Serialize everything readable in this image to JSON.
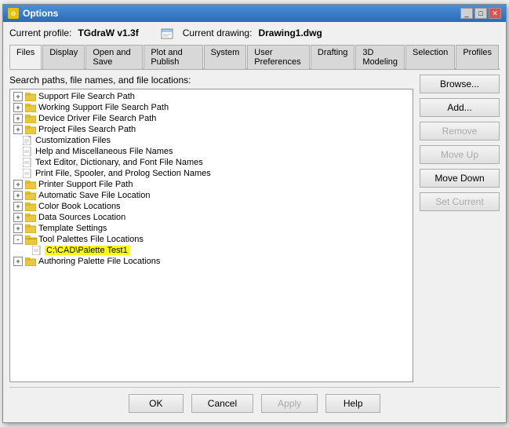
{
  "window": {
    "title": "Options",
    "icon": "⚙",
    "controls": [
      "_",
      "□",
      "✕"
    ]
  },
  "profile_row": {
    "current_profile_label": "Current profile:",
    "current_profile_value": "TGdraW v1.3f",
    "current_drawing_label": "Current drawing:",
    "current_drawing_value": "Drawing1.dwg"
  },
  "tabs": [
    {
      "label": "Files",
      "active": true
    },
    {
      "label": "Display",
      "active": false
    },
    {
      "label": "Open and Save",
      "active": false
    },
    {
      "label": "Plot and Publish",
      "active": false
    },
    {
      "label": "System",
      "active": false
    },
    {
      "label": "User Preferences",
      "active": false
    },
    {
      "label": "Drafting",
      "active": false
    },
    {
      "label": "3D Modeling",
      "active": false
    },
    {
      "label": "Selection",
      "active": false
    },
    {
      "label": "Profiles",
      "active": false
    }
  ],
  "search_paths_label": "Search paths, file names, and file locations:",
  "tree_items": [
    {
      "label": "Support File Search Path",
      "level": 0,
      "type": "folder",
      "expandable": true,
      "expanded": false
    },
    {
      "label": "Working Support File Search Path",
      "level": 0,
      "type": "folder",
      "expandable": true,
      "expanded": false
    },
    {
      "label": "Device Driver File Search Path",
      "level": 0,
      "type": "folder",
      "expandable": true,
      "expanded": false
    },
    {
      "label": "Project Files Search Path",
      "level": 0,
      "type": "folder",
      "expandable": true,
      "expanded": false
    },
    {
      "label": "Customization Files",
      "level": 0,
      "type": "doc",
      "expandable": false
    },
    {
      "label": "Help and Miscellaneous File Names",
      "level": 0,
      "type": "doc",
      "expandable": false
    },
    {
      "label": "Text Editor, Dictionary, and Font File Names",
      "level": 0,
      "type": "doc",
      "expandable": false
    },
    {
      "label": "Print File, Spooler, and Prolog Section Names",
      "level": 0,
      "type": "doc",
      "expandable": false
    },
    {
      "label": "Printer Support File Path",
      "level": 0,
      "type": "folder",
      "expandable": true,
      "expanded": false
    },
    {
      "label": "Automatic Save File Location",
      "level": 0,
      "type": "folder",
      "expandable": true,
      "expanded": false
    },
    {
      "label": "Color Book Locations",
      "level": 0,
      "type": "folder",
      "expandable": true,
      "expanded": false
    },
    {
      "label": "Data Sources Location",
      "level": 0,
      "type": "folder",
      "expandable": true,
      "expanded": false
    },
    {
      "label": "Template Settings",
      "level": 0,
      "type": "folder",
      "expandable": true,
      "expanded": false
    },
    {
      "label": "Tool Palettes File Locations",
      "level": 0,
      "type": "folder_special",
      "expandable": true,
      "expanded": true
    },
    {
      "label": "C:\\CAD\\Palette Test1",
      "level": 1,
      "type": "path",
      "expandable": false,
      "selected": true
    },
    {
      "label": "Authoring Palette File Locations",
      "level": 0,
      "type": "folder",
      "expandable": true,
      "expanded": false
    }
  ],
  "buttons": {
    "browse": "Browse...",
    "add": "Add...",
    "remove": "Remove",
    "move_up": "Move Up",
    "move_down": "Move Down",
    "set_current": "Set Current"
  },
  "bottom_buttons": {
    "ok": "OK",
    "cancel": "Cancel",
    "apply": "Apply",
    "help": "Help"
  }
}
